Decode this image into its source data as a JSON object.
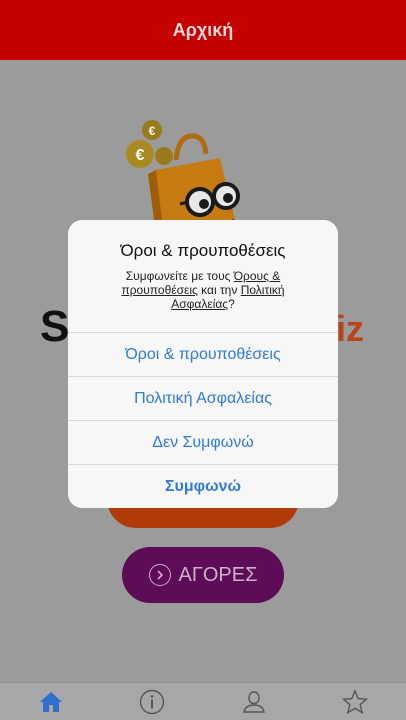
{
  "header": {
    "title": "Αρχική"
  },
  "logo": {
    "left_text": "S",
    "right_text": "iz"
  },
  "buttons": {
    "purchases_label": "ΑΓΟΡΕΣ"
  },
  "modal": {
    "title": "Όροι & προυποθέσεις",
    "message_prefix": "Συμφωνείτε με τους ",
    "message_link_terms": "Όρους & προυποθέσεις",
    "message_middle": " και την ",
    "message_link_privacy": "Πολιτική Ασφαλείας",
    "message_suffix": "?",
    "actions": [
      {
        "label": "Όροι & προυποθέσεις"
      },
      {
        "label": "Πολιτική Ασφαλείας"
      },
      {
        "label": "Δεν Συμφωνώ"
      },
      {
        "label": "Συμφωνώ"
      }
    ]
  },
  "colors": {
    "header_bg": "#c40000",
    "action_text": "#2f7bd8",
    "tab_active": "#2f6fd0",
    "purple_button": "#5e0c58",
    "orange_button": "#b03a08"
  },
  "tabbar": {
    "tabs": [
      {
        "icon": "home-icon",
        "active": true
      },
      {
        "icon": "info-icon",
        "active": false
      },
      {
        "icon": "user-icon",
        "active": false
      },
      {
        "icon": "star-icon",
        "active": false
      }
    ]
  }
}
